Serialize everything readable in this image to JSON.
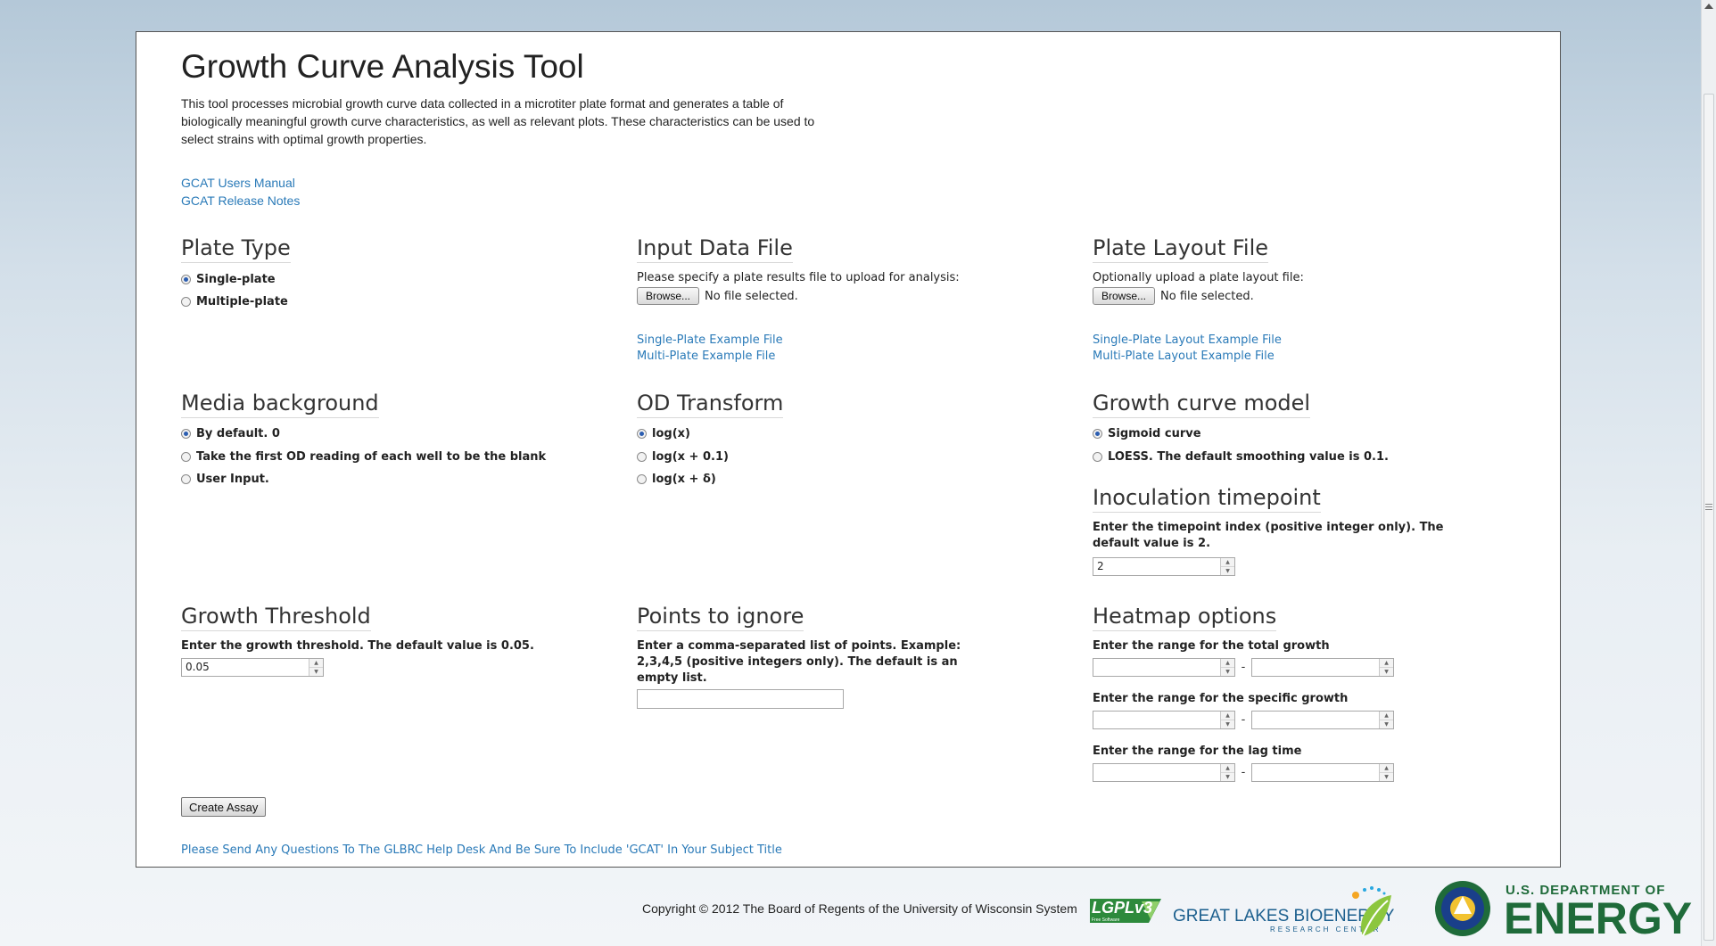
{
  "page": {
    "title": "Growth Curve Analysis Tool",
    "intro": "This tool processes microbial growth curve data collected in a microtiter plate format and generates a table of biologically meaningful growth curve characteristics, as well as relevant plots. These characteristics can be used to select strains with optimal growth properties.",
    "links": {
      "users_manual": "GCAT Users Manual",
      "release_notes": "GCAT Release Notes"
    }
  },
  "plate_type": {
    "title": "Plate Type",
    "options": [
      "Single-plate",
      "Multiple-plate"
    ],
    "selected": "Single-plate"
  },
  "input_data_file": {
    "title": "Input Data File",
    "prompt": "Please specify a plate results file to upload for analysis:",
    "browse_label": "Browse...",
    "status": "No file selected.",
    "example_single": "Single-Plate Example File",
    "example_multi": "Multi-Plate Example File"
  },
  "plate_layout_file": {
    "title": "Plate Layout File",
    "prompt": "Optionally upload a plate layout file:",
    "browse_label": "Browse...",
    "status": "No file selected.",
    "example_single": "Single-Plate Layout Example File",
    "example_multi": "Multi-Plate Layout Example File"
  },
  "media_background": {
    "title": "Media background",
    "options": [
      "By default. 0",
      "Take the first OD reading of each well to be the blank",
      "User Input."
    ],
    "selected": "By default. 0"
  },
  "od_transform": {
    "title": "OD Transform",
    "options": [
      "log(x)",
      "log(x + 0.1)",
      "log(x + δ)"
    ],
    "selected": "log(x)"
  },
  "growth_curve_model": {
    "title": "Growth curve model",
    "options": [
      "Sigmoid curve",
      "LOESS. The default smoothing value is 0.1."
    ],
    "selected": "Sigmoid curve"
  },
  "inoculation_timepoint": {
    "title": "Inoculation timepoint",
    "label": "Enter the timepoint index (positive integer only). The default value is 2.",
    "value": "2"
  },
  "growth_threshold": {
    "title": "Growth Threshold",
    "label": "Enter the growth threshold. The default value is 0.05.",
    "value": "0.05"
  },
  "points_to_ignore": {
    "title": "Points to ignore",
    "label": "Enter a comma-separated list of points. Example: 2,3,4,5 (positive integers only). The default is an empty list.",
    "value": ""
  },
  "heatmap_options": {
    "title": "Heatmap options",
    "total_growth_label": "Enter the range for the total growth",
    "specific_growth_label": "Enter the range for the specific growth",
    "lag_time_label": "Enter the range for the lag time",
    "range_separator": "-"
  },
  "actions": {
    "create_assay": "Create Assay"
  },
  "footer": {
    "help": "Please Send Any Questions To The GLBRC Help Desk And Be Sure To Include 'GCAT' In Your Subject Title",
    "copyright": "Copyright © 2012 The Board of Regents of the University of Wisconsin System",
    "lgpl_logo": "LGPLv3",
    "lgpl_sub": "Free Software",
    "glbrc_name": "GREAT LAKES BIOENERGY",
    "glbrc_sub": "RESEARCH CENTER",
    "doe_top": "U.S. DEPARTMENT OF",
    "doe_big": "ENERGY"
  },
  "colors": {
    "link": "#2a7ab8",
    "radio_selected": "#2b5db0",
    "doe_green": "#1f6b3a",
    "glbrc_blue": "#1c5f8e"
  }
}
